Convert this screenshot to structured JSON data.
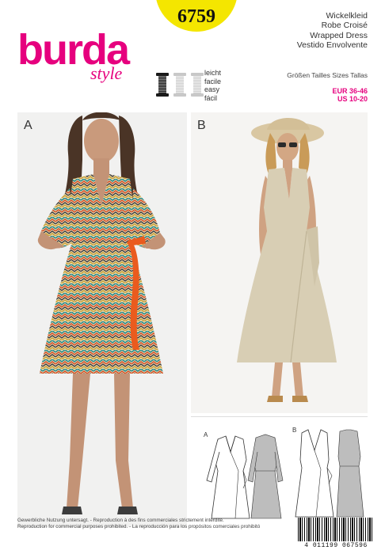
{
  "brand": {
    "logo_main": "burda",
    "logo_sub": "style",
    "color": "#e6007e"
  },
  "pattern_number": "6759",
  "titles": [
    "Wickelkleid",
    "Robe Croisé",
    "Wrapped Dress",
    "Vestido Envolvente"
  ],
  "difficulty": {
    "level_icons": 1,
    "level_total": 3,
    "labels": [
      "leicht",
      "facile",
      "easy",
      "fácil"
    ]
  },
  "sizes": {
    "label": "Größen Tailles Sizes Tallas",
    "eur": "EUR 36-46",
    "us": "US 10-20"
  },
  "photos": [
    {
      "label": "A",
      "icon": "woman-zigzag-wrap-dress-photo"
    },
    {
      "label": "B",
      "icon": "woman-beige-wrap-dress-hat-photo"
    }
  ],
  "tech_drawings": [
    {
      "label": "A"
    },
    {
      "label": "B"
    }
  ],
  "footer": {
    "line1": "Gewerbliche Nutzung untersagt. - Reproduction à des fins commerciales strictement interdite.",
    "line2": "Reproduction for commercial purposes prohibited. - La reproducción para los propósitos comerciales prohibitó"
  },
  "barcode": "4 011199 067596"
}
